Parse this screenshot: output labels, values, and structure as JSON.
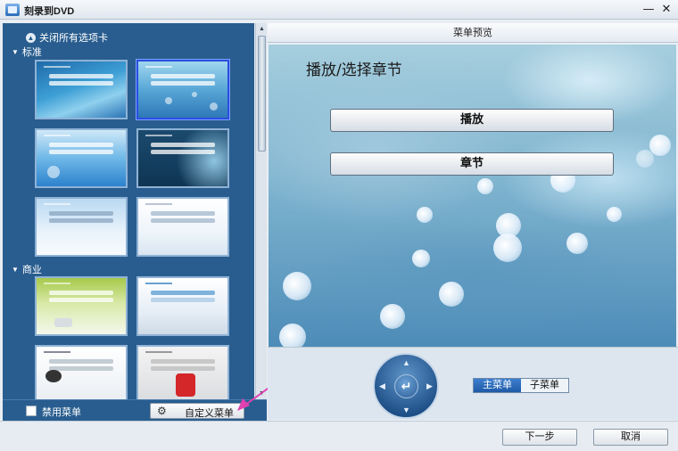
{
  "window": {
    "title": "刻录到DVD",
    "minimize_glyph": "—",
    "close_glyph": "✕"
  },
  "left_panel": {
    "close_all_label": "关闭所有选项卡",
    "close_all_icon": "collapse-icon",
    "categories": [
      {
        "label": "标准",
        "templates": [
          "template-standard-1",
          "template-standard-2",
          "template-standard-3",
          "template-standard-4",
          "template-standard-5",
          "template-standard-6"
        ]
      },
      {
        "label": "商业",
        "templates": [
          "template-business-1",
          "template-business-2",
          "template-business-3",
          "template-business-4"
        ]
      }
    ],
    "selected_template": "template-standard-2",
    "disable_menu_label": "禁用菜单",
    "disable_menu_checked": false,
    "custom_menu_label": "自定义菜单",
    "custom_menu_icon": "gear-icon"
  },
  "preview": {
    "header": "菜单预览",
    "title": "播放/选择章节",
    "play_button": "播放",
    "chapters_button": "章节",
    "nav_center_glyph": "↵",
    "tabs": {
      "main": "主菜单",
      "sub": "子菜单",
      "active": "主菜单"
    }
  },
  "footer": {
    "next_label": "下一步",
    "cancel_label": "取消"
  },
  "colors": {
    "panel_bg": "#295d8f",
    "selected_border": "#2a4fe0",
    "annotation_arrow": "#e040b0"
  }
}
